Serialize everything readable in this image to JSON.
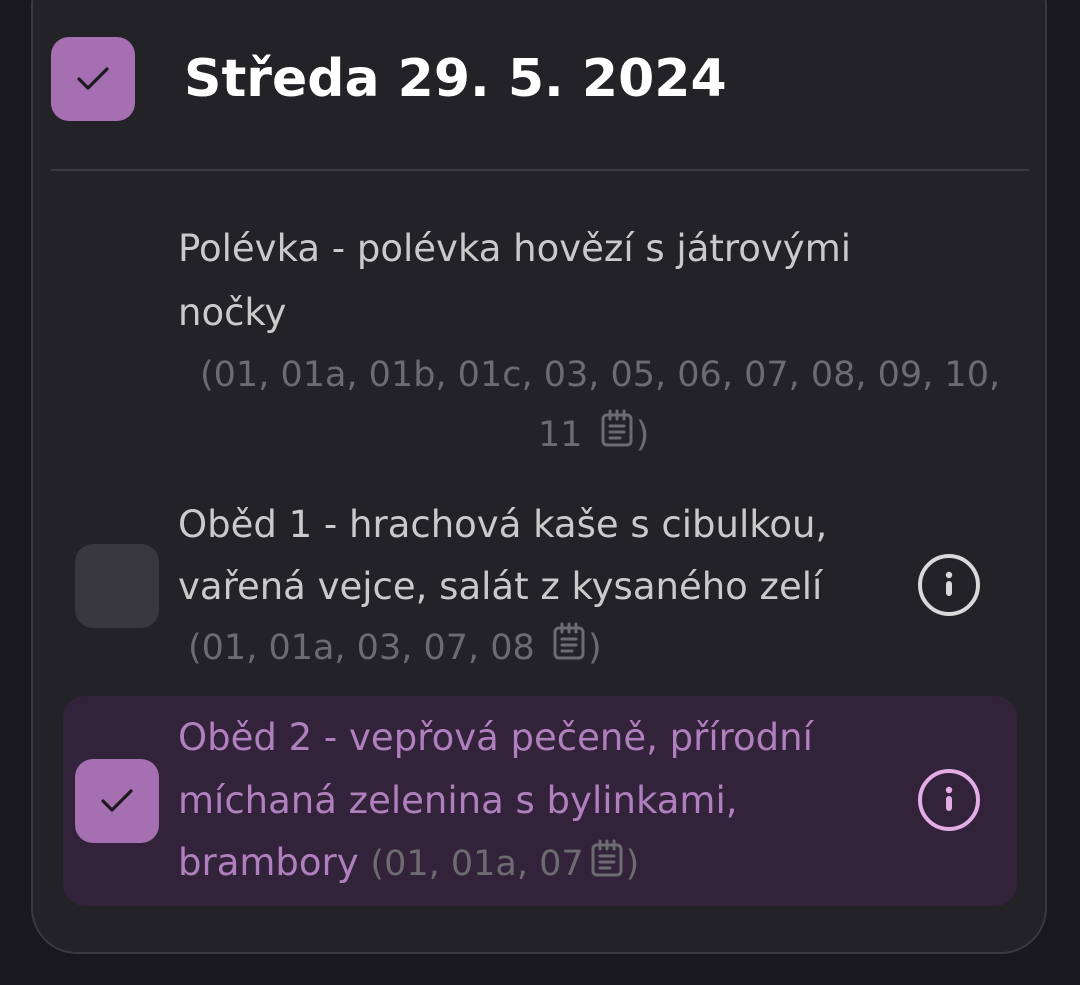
{
  "day": {
    "title": "Středa 29. 5. 2024",
    "checked": true
  },
  "meals": [
    {
      "line1": "Polévka - polévka hovězí s játrovými",
      "line2": "nočky",
      "allergens_line1": "(01, 01a, 01b, 01c, 03, 05, 06, 07, 08, 09, 10,",
      "allergens_line2_prefix": "11",
      "allergens_close": ")",
      "icon": "notepad-icon"
    },
    {
      "line1": "Oběd 1 - hrachová kaše s cibulkou,",
      "line2": "vařená vejce, salát z kysaného zelí",
      "allergens_prefix": "(01, 01a, 03, 07, 08",
      "allergens_close": ")",
      "checked": false,
      "icon": "notepad-icon",
      "info_icon": "info-icon"
    },
    {
      "line1": "Oběd 2 - vepřová pečeně, přírodní",
      "line2": "míchaná zelenina s bylinkami,",
      "line3": "brambory",
      "allergens_prefix": "(01, 01a, 07",
      "allergens_close": ")",
      "checked": true,
      "icon": "notepad-icon",
      "info_icon": "info-icon"
    }
  ],
  "colors": {
    "accent": "#a56fb1",
    "selected_text": "#b07fbd",
    "selected_row_bg": "#32233a",
    "card_bg": "#232226",
    "text": "#cacaca",
    "muted": "#6c6b70"
  }
}
